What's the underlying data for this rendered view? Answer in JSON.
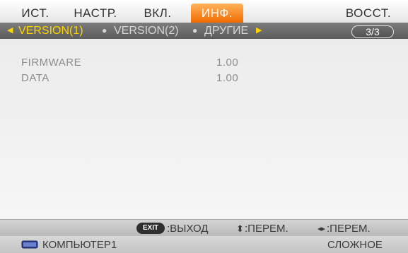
{
  "tabs": [
    {
      "label": "ИСТ."
    },
    {
      "label": "НАСТР."
    },
    {
      "label": "ВКЛ."
    },
    {
      "label": "ИНФ."
    },
    {
      "label": "ВОССТ."
    }
  ],
  "subtabs": [
    {
      "label": "VERSION(1)"
    },
    {
      "label": "VERSION(2)"
    },
    {
      "label": "ДРУГИЕ"
    }
  ],
  "page_indicator": "3/3",
  "info_rows": [
    {
      "label": "FIRMWARE",
      "value": "1.00"
    },
    {
      "label": "DATA",
      "value": "1.00"
    }
  ],
  "footer": {
    "exit_key": "EXIT",
    "exit_label": ":ВЫХОД",
    "updown_label": ":ПЕРЕМ.",
    "leftright_label": ":ПЕРЕМ."
  },
  "status": {
    "source": "КОМПЬЮТЕР1",
    "mode": "СЛОЖНОЕ"
  },
  "colors": {
    "active_tab": "#f26b00",
    "active_subtab": "#ffd400",
    "subtab_bar": "#6a6a6a"
  },
  "icons": [
    "left-arrow-icon",
    "bullet-icon",
    "right-arrow-icon",
    "updown-arrow-icon",
    "leftright-arrow-icon",
    "monitor-icon"
  ]
}
